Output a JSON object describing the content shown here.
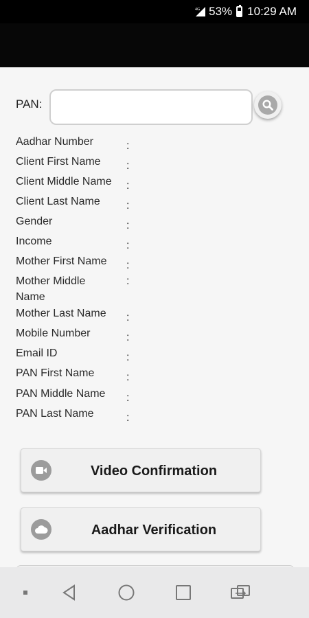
{
  "status_bar": {
    "network": "4G",
    "battery": "53%",
    "time": "10:29 AM"
  },
  "pan": {
    "label": "PAN:",
    "value": "",
    "placeholder": ""
  },
  "fields": [
    {
      "label": "Aadhar Number",
      "separator": ":"
    },
    {
      "label": "Client First Name",
      "separator": ":"
    },
    {
      "label": "Client Middle Name",
      "separator": ":"
    },
    {
      "label": "Client Last Name",
      "separator": ":"
    },
    {
      "label": "Gender",
      "separator": ":"
    },
    {
      "label": "Income",
      "separator": ":"
    },
    {
      "label": "Mother First Name",
      "separator": ":"
    },
    {
      "label": "Mother Middle Name",
      "separator": ":"
    },
    {
      "label": "Mother Last Name",
      "separator": ":"
    },
    {
      "label": "Mobile Number",
      "separator": ":"
    },
    {
      "label": "Email ID",
      "separator": ":"
    },
    {
      "label": "PAN First Name",
      "separator": ":"
    },
    {
      "label": "PAN Middle Name",
      "separator": ":"
    },
    {
      "label": "PAN Last Name",
      "separator": ":"
    }
  ],
  "buttons": [
    {
      "label": "Video Confirmation",
      "icon": "video-camera-icon"
    },
    {
      "label": "Aadhar Verification",
      "icon": "cloud-icon"
    }
  ],
  "nav_bar": {
    "items": [
      "dot-icon",
      "back-icon",
      "home-icon",
      "recents-icon",
      "switch-app-icon"
    ]
  },
  "colors": {
    "app_bar": "#070707",
    "background": "#f6f6f6",
    "button_bg": "#f0f0f0",
    "icon_grey": "#9c9c9c"
  }
}
